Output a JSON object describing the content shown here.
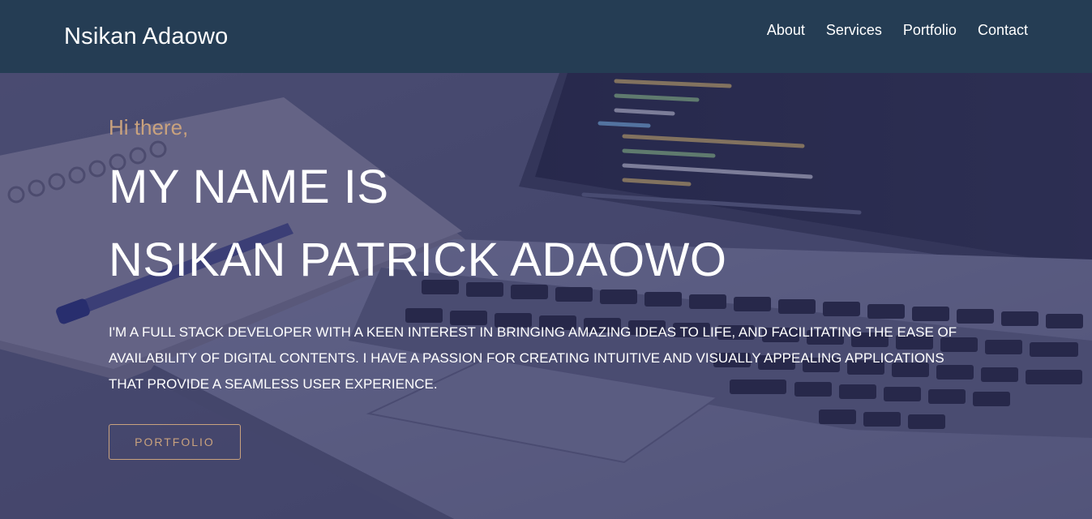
{
  "navbar": {
    "brand": "Nsikan Adaowo",
    "links": [
      {
        "label": "About"
      },
      {
        "label": "Services"
      },
      {
        "label": "Portfolio"
      },
      {
        "label": "Contact"
      }
    ]
  },
  "hero": {
    "greeting": "Hi there,",
    "headline_line1": "MY NAME IS",
    "headline_line2": "NSIKAN PATRICK ADAOWO",
    "bio": "I'M A FULL STACK DEVELOPER WITH A KEEN INTEREST IN BRINGING AMAZING IDEAS TO LIFE, AND FACILITATING THE EASE OF AVAILABILITY OF DIGITAL CONTENTS. I HAVE A PASSION FOR CREATING INTUITIVE AND VISUALLY APPEALING APPLICATIONS THAT PROVIDE A SEAMLESS USER EXPERIENCE.",
    "cta_label": "PORTFOLIO"
  },
  "colors": {
    "navbar_bg": "#253d54",
    "accent": "#c9a27e",
    "overlay": "#303264",
    "text": "#ffffff"
  }
}
